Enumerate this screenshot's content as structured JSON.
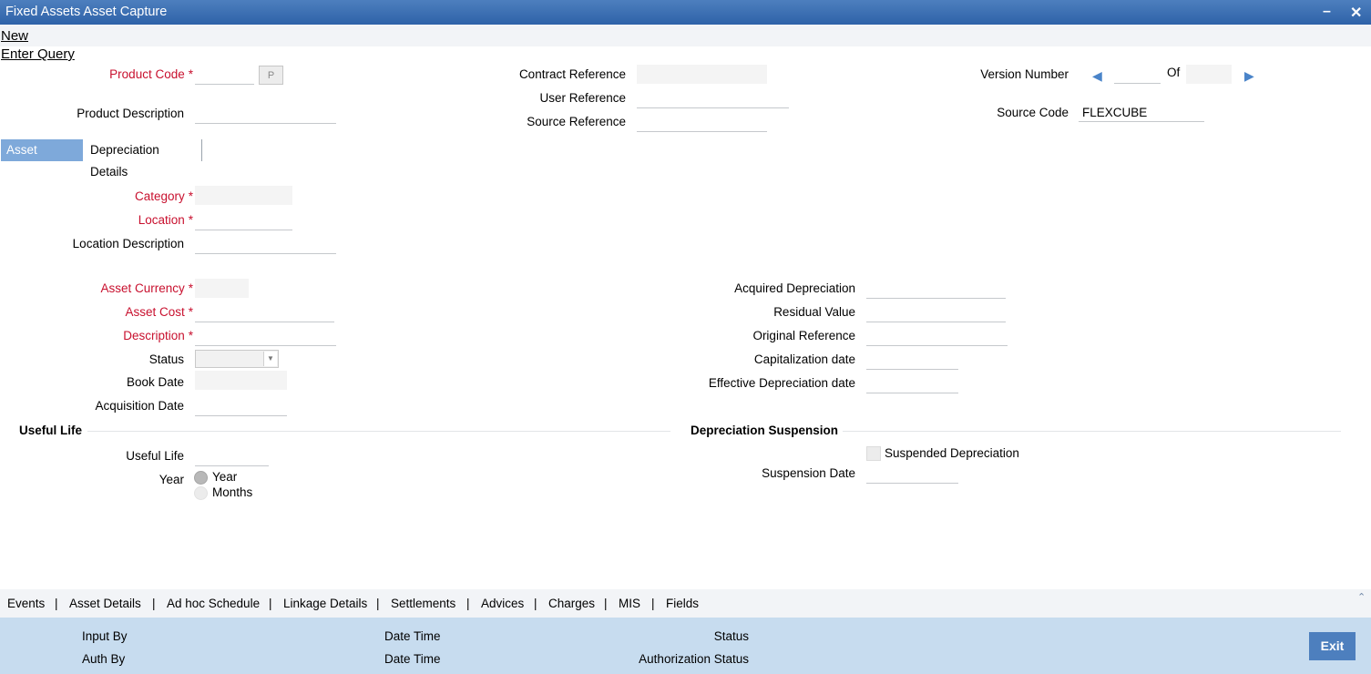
{
  "window": {
    "title": "Fixed Assets Asset Capture"
  },
  "menu": {
    "new": "New",
    "enter_query": "Enter Query"
  },
  "header": {
    "product_code_label": "Product Code",
    "product_code_value": "",
    "product_button": "P",
    "product_description_label": "Product Description",
    "product_description_value": "",
    "contract_reference_label": "Contract Reference",
    "user_reference_label": "User Reference",
    "source_reference_label": "Source Reference",
    "version_number_label": "Version Number",
    "of_label": "Of",
    "source_code_label": "Source Code",
    "source_code_value": "FLEXCUBE"
  },
  "tabs": [
    {
      "label": "Asset Details",
      "active": true
    },
    {
      "label": "Depreciation Details",
      "active": false
    }
  ],
  "asset_details": {
    "category_label": "Category",
    "location_label": "Location",
    "location_description_label": "Location Description",
    "asset_currency_label": "Asset Currency",
    "asset_cost_label": "Asset Cost",
    "description_label": "Description",
    "status_label": "Status",
    "status_value": "",
    "book_date_label": "Book Date",
    "acquisition_date_label": "Acquisition Date",
    "acquired_depreciation_label": "Acquired Depreciation",
    "residual_value_label": "Residual Value",
    "original_reference_label": "Original Reference",
    "capitalization_date_label": "Capitalization date",
    "effective_depreciation_date_label": "Effective Depreciation date"
  },
  "useful_life": {
    "section_title": "Useful Life",
    "useful_life_label": "Useful Life",
    "year_label": "Year",
    "options": [
      {
        "label": "Year",
        "selected": true
      },
      {
        "label": "Months",
        "selected": false
      }
    ]
  },
  "depreciation_suspension": {
    "section_title": "Depreciation Suspension",
    "suspended_label": "Suspended Depreciation",
    "suspended_checked": false,
    "suspension_date_label": "Suspension Date"
  },
  "bottom_tabs": [
    "Events",
    "Asset Details",
    "Ad hoc Schedule",
    "Linkage Details",
    "Settlements",
    "Advices",
    "Charges",
    "MIS",
    "Fields"
  ],
  "footer": {
    "input_by": "Input By",
    "auth_by": "Auth By",
    "date_time_1": "Date Time",
    "date_time_2": "Date Time",
    "status": "Status",
    "authorization_status": "Authorization Status",
    "exit": "Exit"
  },
  "colors": {
    "accent": "#2e62a8",
    "required": "#c8102e",
    "footer_bg": "#c7dcef",
    "active_tab": "#7ea9da"
  },
  "icons": {
    "minimize": "minimize-icon",
    "close": "close-icon",
    "prev": "triangle-left-icon",
    "next": "triangle-right-icon",
    "scroll_up": "chevron-up-icon"
  }
}
